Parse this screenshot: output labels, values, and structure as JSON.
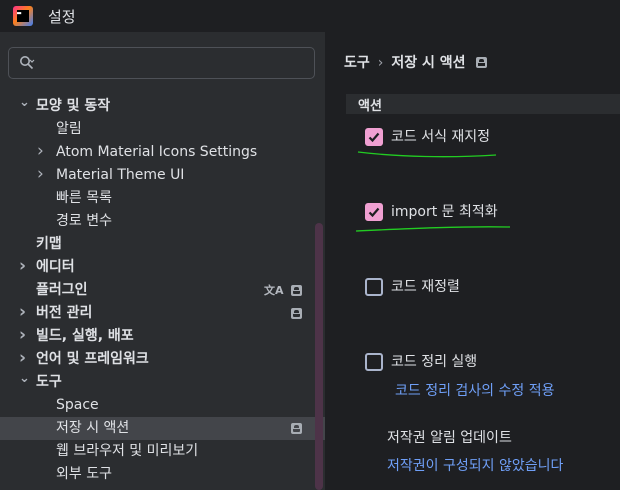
{
  "window": {
    "title": "설정"
  },
  "search": {
    "placeholder": "",
    "value": ""
  },
  "tree": [
    {
      "label": "모양 및 동작",
      "indent": 0,
      "expanded": true,
      "bold": true
    },
    {
      "label": "알림",
      "indent": 1
    },
    {
      "label": "Atom Material Icons Settings",
      "indent": 1,
      "collapsed": true
    },
    {
      "label": "Material Theme UI",
      "indent": 1,
      "collapsed": true
    },
    {
      "label": "빠른 목록",
      "indent": 1
    },
    {
      "label": "경로 변수",
      "indent": 1
    },
    {
      "label": "키맵",
      "indent": 0,
      "bold": true
    },
    {
      "label": "에디터",
      "indent": 0,
      "collapsed": true,
      "bold": true
    },
    {
      "label": "플러그인",
      "indent": 0,
      "bold": true,
      "translate_icon": true,
      "badge": true
    },
    {
      "label": "버전 관리",
      "indent": 0,
      "collapsed": true,
      "bold": true,
      "badge": true
    },
    {
      "label": "빌드, 실행, 배포",
      "indent": 0,
      "collapsed": true,
      "bold": true
    },
    {
      "label": "언어 및 프레임워크",
      "indent": 0,
      "collapsed": true,
      "bold": true
    },
    {
      "label": "도구",
      "indent": 0,
      "expanded": true,
      "bold": true
    },
    {
      "label": "Space",
      "indent": 1
    },
    {
      "label": "저장 시 액션",
      "indent": 1,
      "selected": true,
      "badge": true
    },
    {
      "label": "웹 브라우저 및 미리보기",
      "indent": 1
    },
    {
      "label": "외부 도구",
      "indent": 1
    }
  ],
  "breadcrumb": {
    "parent": "도구",
    "separator": "›",
    "current": "저장 시 액션"
  },
  "section": {
    "title": "액션"
  },
  "options": [
    {
      "label": "코드 서식 재지정",
      "checked": true
    },
    {
      "label": "import 문 최적화",
      "checked": true
    },
    {
      "label": "코드 재정렬",
      "checked": false
    },
    {
      "label": "코드 정리 실행",
      "checked": false
    }
  ],
  "cleanup_link": "코드 정리 검사의 수정 적용",
  "copyright": {
    "title": "저작권 알림 업데이트",
    "link": "저작권이 구성되지 않았습니다"
  },
  "colors": {
    "accent_check": "#f0a0d2",
    "link": "#6f9ff7",
    "annotation": "#22cc22",
    "selection": "#43454a",
    "scrollbar": "#4d3348"
  }
}
